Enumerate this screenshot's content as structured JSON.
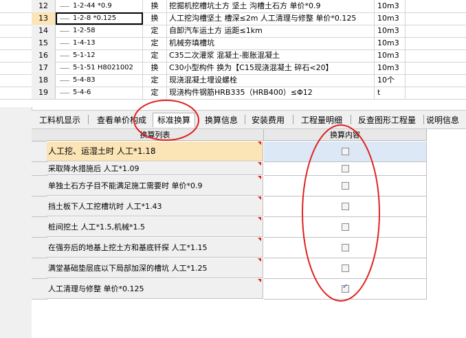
{
  "top_grid": {
    "rows": [
      {
        "num": "12",
        "code": "1-2-44 *0.9",
        "type": "换",
        "name": "挖掘机挖槽坑土方 坚土 沟槽土石方 单价*0.9",
        "unit": "10m3"
      },
      {
        "num": "13",
        "code": "1-2-8 *0.125",
        "type": "换",
        "name": "人工挖沟槽坚土 槽深≤2m 人工清理与修整 单价*0.125",
        "unit": "10m3"
      },
      {
        "num": "14",
        "code": "1-2-58",
        "type": "定",
        "name": "自卸汽车运土方 运距≤1km",
        "unit": "10m3"
      },
      {
        "num": "15",
        "code": "1-4-13",
        "type": "定",
        "name": "机械夯填槽坑",
        "unit": "10m3"
      },
      {
        "num": "16",
        "code": "5-1-12",
        "type": "定",
        "name": "C35二次灌浆 混凝土-膨胀混凝土",
        "unit": "10m3"
      },
      {
        "num": "17",
        "code": "5-1-51 H8021002",
        "type": "换",
        "name": "C30小型构件 换为【C15现浇混凝土 碎石<20】",
        "unit": "10m3"
      },
      {
        "num": "18",
        "code": "5-4-83",
        "type": "定",
        "name": "现浇混凝土埋设螺栓",
        "unit": "10个"
      },
      {
        "num": "19",
        "code": "5-4-6",
        "type": "定",
        "name": "现浇构件钢筋HRB335（HRB400）≤Φ12",
        "unit": "t"
      }
    ]
  },
  "tabs": [
    "工料机显示",
    "查看单价构成",
    "标准换算",
    "换算信息",
    "安装费用",
    "工程量明细",
    "反查图形工程量",
    "说明信息"
  ],
  "lower_grid": {
    "header_list": "换算列表",
    "header_content": "换算内容",
    "rows": [
      {
        "label": "人工挖、运湿土时 人工*1.18",
        "checked": false
      },
      {
        "label": "采取降水措施后 人工*1.09",
        "checked": false
      },
      {
        "label": "单独土石方子目不能满足施工需要时 单价*0.9",
        "checked": false
      },
      {
        "label": "挡土板下人工挖槽坑时 人工*1.43",
        "checked": false
      },
      {
        "label": "桩间挖土 人工*1.5,机械*1.5",
        "checked": false
      },
      {
        "label": "在强夯后的地基上挖土方和基底钎探 人工*1.15",
        "checked": false
      },
      {
        "label": "满堂基础垫层底以下局部加深的槽坑 人工*1.25",
        "checked": false
      },
      {
        "label": "人工清理与修整 单价*0.125",
        "checked": true
      }
    ]
  },
  "colors": {
    "selected_row": "#fbe4b6",
    "annotation": "#e02020",
    "check": "#1f4fa8"
  }
}
